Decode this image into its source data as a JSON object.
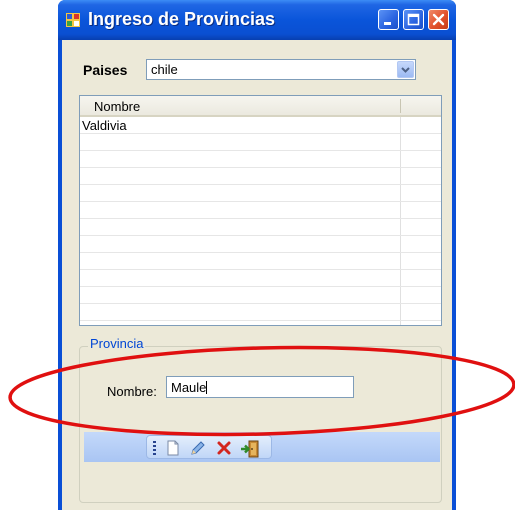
{
  "window": {
    "title": "Ingreso de Provincias",
    "icons": {
      "app": "app-form-icon",
      "minimize": "minimize-icon",
      "maximize": "maximize-icon",
      "close": "close-icon"
    }
  },
  "countries": {
    "label": "Paises",
    "selected": "chile",
    "dropdown_icon": "chevron-down-icon"
  },
  "grid": {
    "columns": [
      "Nombre"
    ],
    "rows": [
      [
        "Valdivia"
      ]
    ]
  },
  "provincia": {
    "group_title": "Provincia",
    "name_label": "Nombre:",
    "name_value": "Maule"
  },
  "toolbar": {
    "items": [
      {
        "name": "new",
        "icon": "new-document-icon"
      },
      {
        "name": "edit",
        "icon": "pencil-icon"
      },
      {
        "name": "delete",
        "icon": "delete-x-icon"
      },
      {
        "name": "exit",
        "icon": "exit-door-icon"
      }
    ]
  },
  "annotation": {
    "shape": "ellipse",
    "color": "#e01010"
  },
  "colors": {
    "titlebar": "#0a55da",
    "client": "#ece9d8",
    "group_title": "#0046d5",
    "close_button": "#e2512c"
  }
}
